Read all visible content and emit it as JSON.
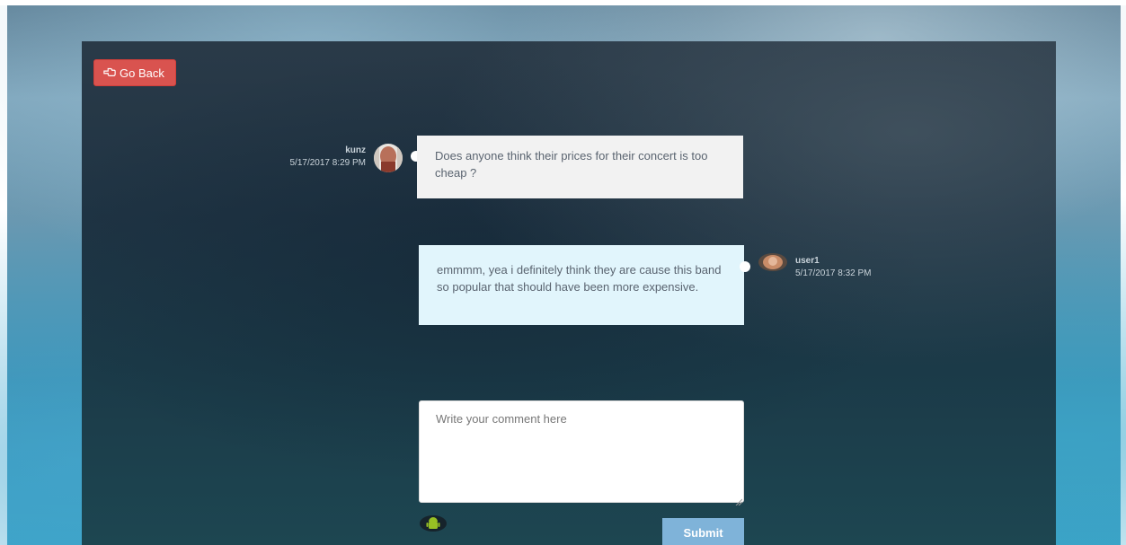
{
  "nav": {
    "go_back_label": "Go Back"
  },
  "messages": [
    {
      "username": "kunz",
      "timestamp": "5/17/2017 8:29 PM",
      "text": "Does anyone think their prices for their concert is too cheap ?",
      "side": "left",
      "bubble_color": "#f2f2f2"
    },
    {
      "username": "user1",
      "timestamp": "5/17/2017 8:32 PM",
      "text": "emmmm, yea i definitely think they are cause this band so popular that should have been more expensive.",
      "side": "right",
      "bubble_color": "#e1f5fc"
    }
  ],
  "comment_form": {
    "placeholder": "Write your comment here",
    "value": "",
    "submit_label": "Submit"
  },
  "colors": {
    "go_back": "#d9534f",
    "submit": "#7fb3d9"
  },
  "icons": {
    "go_back": "hand-pointing-left-icon",
    "attachment": "android-icon"
  }
}
